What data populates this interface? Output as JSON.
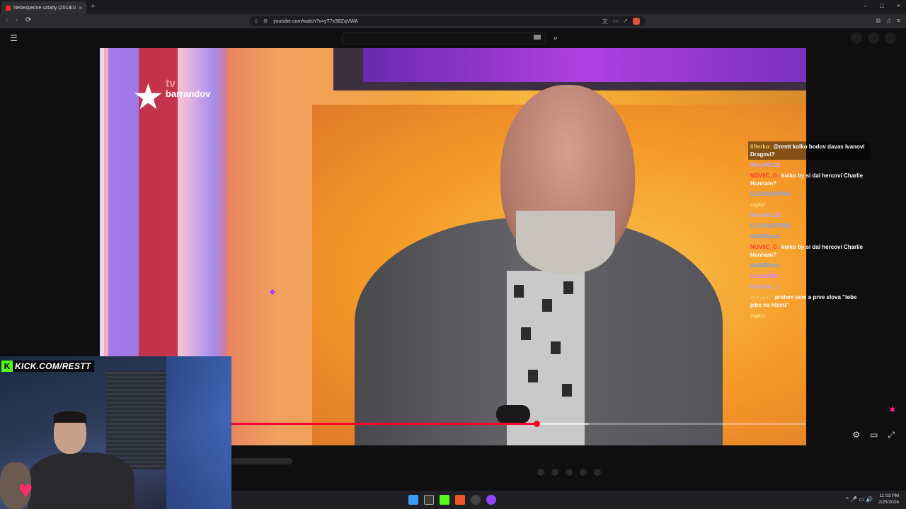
{
  "browser": {
    "tab_title": "Nebezpečné vztahy (2018/10",
    "tab_close": "×",
    "new_tab": "+",
    "window_controls": [
      "–",
      "□",
      "×"
    ],
    "back": "‹",
    "forward": "›",
    "reload": "⟳",
    "url": "youtube.com/watch?v=yT7x3BZqVWA"
  },
  "youtube": {
    "menu_icon": "☰",
    "search_icon": "⌕"
  },
  "video": {
    "channel_logo_tv": "tv",
    "channel_logo_brand": "barrandov",
    "progress": 0.531,
    "buffered": 0.622
  },
  "chat": [
    {
      "name": "lifterko:",
      "text": "@restt kolko bodov davas Ivanovi Dragovi?",
      "color": "#f0c060",
      "highlight": true
    },
    {
      "name": "WeeeW123",
      "text": "",
      "color": "#b9a8ff"
    },
    {
      "name": "NOVIIC_G:",
      "text": "kolko by si dal hercovi Charlie Hunnam?",
      "color": "#ff3b3b"
    },
    {
      "name": "ELCHAAPPOO:",
      "text": "",
      "color": "#7aa8ff"
    },
    {
      "name": "rapty:",
      "text": "",
      "color": "#f5e27a"
    },
    {
      "name": "WeeeW123:",
      "text": "",
      "color": "#b9a8ff"
    },
    {
      "name": "ELCHAAPPOO:",
      "text": "",
      "color": "#7aa8ff"
    },
    {
      "name": "dx0000xxx:",
      "text": "",
      "color": "#6aa0ff"
    },
    {
      "name": "NOVIIC_G:",
      "text": "kolko by si dal hercovi Charlie Hunnam?",
      "color": "#ff3b3b"
    },
    {
      "name": "dx0000xxx:",
      "text": "",
      "color": "#6aa0ff"
    },
    {
      "name": "toretto888:",
      "text": "",
      "color": "#d08aff"
    },
    {
      "name": "Davidek_1:",
      "text": "",
      "color": "#c0a0ff"
    },
    {
      "name": "jerryket:",
      "text": "pridem sem a prve slova \"tebe jebe na hlavu\"",
      "color": "#f0c060"
    },
    {
      "name": "rapty:",
      "text": "",
      "color": "#f5e27a"
    }
  ],
  "webcam": {
    "kick_logo": "K",
    "kick_text": "KICK.COM/RESTT"
  },
  "taskbar": {
    "time": "11:03 PM",
    "date": "2/25/2026",
    "tray": "^ 🎤 ▭ 🔊"
  },
  "colors": {
    "accent": "#ff0033",
    "kick_green": "#53fc18"
  }
}
